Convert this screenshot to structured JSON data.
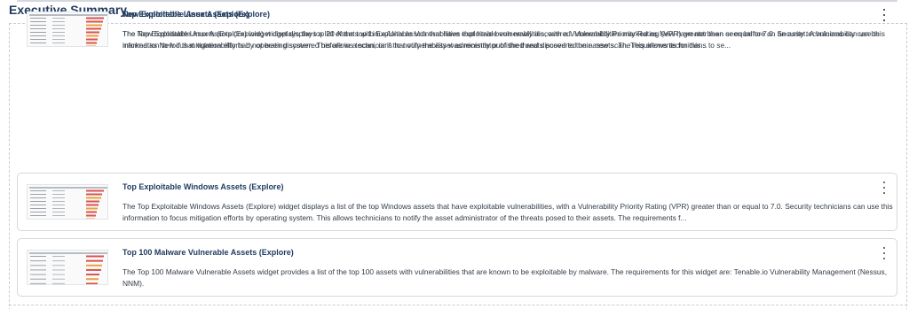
{
  "section": {
    "title": "Executive Summary"
  },
  "widgets": [
    {
      "title": "Top Exploitable Windows Assets (Explore)",
      "description": "The Top Exploitable Windows Assets (Explore) widget displays a list of the top Windows assets that have exploitable vulnerabilities, with a Vulnerability Priority Rating (VPR) greater than or equal to 7.0. Security technicians can use this information to focus mitigation efforts by operating system. This allows technicians to notify the asset administrator of the threats posed to their assets. The requirements f...",
      "menu_icon": "kebab-menu-icon",
      "thumbnail": {
        "bars": [
          0.9,
          0.8,
          0.75,
          0.7,
          0.65,
          0.6,
          0.55,
          0.5,
          0.45
        ],
        "accent": "#d9534f",
        "accent2": "#e8a23c"
      }
    },
    {
      "title": "Top 100 Malware Vulnerable Assets (Explore)",
      "description": "The Top 100 Malware Vulnerable Assets widget provides a list of the top 100 assets with vulnerabilities that are known to be exploitable by malware. The requirements for this widget are: Tenable.io Vulnerability Management (Nessus, NNM).",
      "menu_icon": "kebab-menu-icon",
      "thumbnail": {
        "bars": [
          0.9,
          0.85,
          0.8,
          0.75,
          0.7,
          0.65,
          0.6
        ],
        "accent": "#d9534f",
        "accent2": "#e8a23c"
      }
    },
    {
      "title": "Top Exploitable Linux Assets (Explore)",
      "description": "The Top Exploitable Linux Assets (Explore) widget displays a list of the top Linux/Unix assets that have exploitable vulnerabilities, with a Vulnerability Priority Rating (VPR) greater than or equal to 7.0. Security technicians can use this information to focus mitigation efforts by operating system. This allows technicians to notify the asset administrator of the threats posed to their assets. The requirements for this...",
      "menu_icon": "kebab-menu-icon",
      "thumbnail": {
        "bars": [
          0.95,
          0.85,
          0.8,
          0.7,
          0.65,
          0.6,
          0.55,
          0.5,
          0.45
        ],
        "accent": "#d9534f",
        "accent2": "#e8a23c"
      }
    },
    {
      "title": "New Exploitable Assets (Explore)",
      "description": "The New Exploitable Assets (Explore) widget displays the top 20 Assets with Exploitable Vulnerabilities that have been newly discovered. Vulnerabilities marked as New have not been seen before on an asset. A vulnerability can be marked as New if that vulnerability had not been discovered before in a scan, or if that vulnerability was recently published and discovered on a new scan. This allows technicians to se...",
      "menu_icon": "kebab-menu-icon",
      "thumbnail": {
        "bars": [
          0.9,
          0.85,
          0.8,
          0.75,
          0.7,
          0.65,
          0.6,
          0.55,
          0.5
        ],
        "accent": "#d9534f",
        "accent2": "#e8a23c"
      }
    }
  ]
}
